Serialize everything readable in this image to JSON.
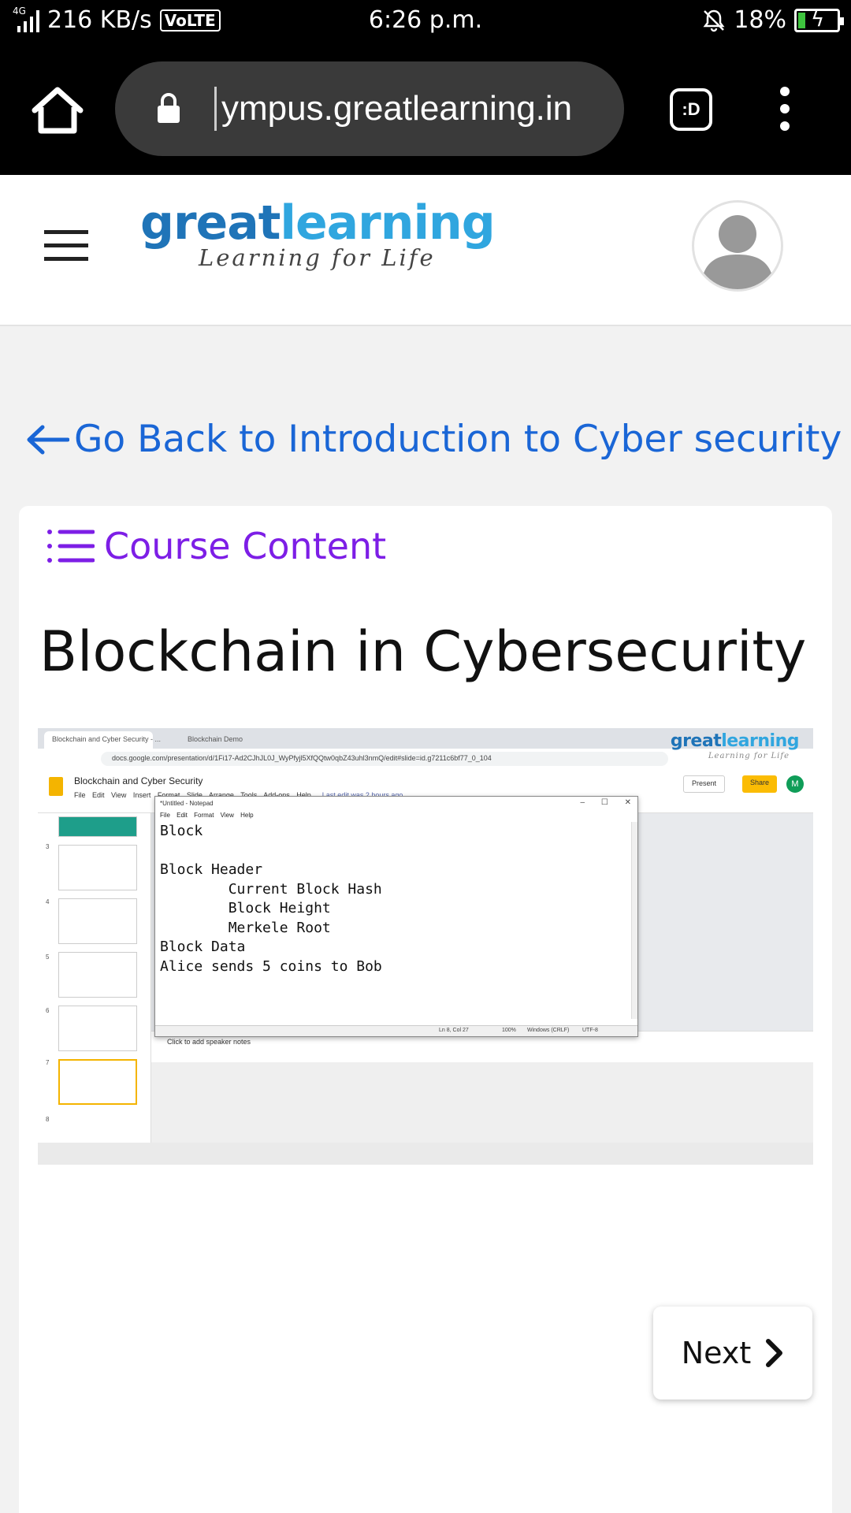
{
  "status_bar": {
    "network_type": "4G",
    "data_speed": "216 KB/s",
    "volte": "VoLTE",
    "time": "6:26 p.m.",
    "battery_percent": "18%",
    "battery_level": 0.18
  },
  "browser": {
    "url": "ympus.greatlearning.in",
    "tab_switcher_label": ":D"
  },
  "site_header": {
    "logo_part1": "great",
    "logo_part2": "learning",
    "logo_tagline": "Learning for Life"
  },
  "nav": {
    "back_link": "Go Back to Introduction to Cyber security"
  },
  "content": {
    "course_content_label": "Course Content",
    "lesson_title": "Blockchain in Cybersecurity"
  },
  "video_frame": {
    "tab1": "Blockchain and Cyber Security - ...",
    "tab2": "Blockchain Demo",
    "address": "docs.google.com/presentation/d/1Fi17-Ad2CJhJL0J_WyPfyjl5XfQQtw0qbZ43uhl3nmQ/edit#slide=id.g7211c6bf77_0_104",
    "overlay_logo_part1": "great",
    "overlay_logo_part2": "learning",
    "overlay_tagline": "Learning for Life",
    "doc_title": "Blockchain and Cyber Security",
    "menus": "File Edit View Insert Format Slide Arrange Tools Add-ons Help",
    "last_edit": "Last edit was 2 hours ago",
    "present_label": "Present",
    "share_label": "Share",
    "user_initial": "M",
    "slide_numbers": [
      "3",
      "4",
      "5",
      "6",
      "7",
      "8"
    ],
    "speaker_notes": "Click to add speaker notes",
    "notepad": {
      "title": "*Untitled - Notepad",
      "menu": "File Edit Format View Help",
      "lines": [
        "Block",
        "",
        "Block Header",
        "        Current Block Hash",
        "        Block Height",
        "        Merkele Root",
        "Block Data",
        "Alice sends 5 coins to Bob"
      ],
      "status_position": "Ln 8, Col 27",
      "status_zoom": "100%",
      "status_eol": "Windows (CRLF)",
      "status_encoding": "UTF-8"
    }
  },
  "pagination": {
    "next_label": "Next"
  },
  "colors": {
    "link_blue": "#1a66d6",
    "course_purple": "#7d1ee6",
    "logo_dark_blue": "#1f74b8",
    "logo_light_blue": "#30a6df"
  },
  "icons": [
    "home-icon",
    "lock-icon",
    "overflow-menu-icon",
    "hamburger-icon",
    "avatar-icon",
    "back-arrow-icon",
    "list-icon",
    "chevron-right-icon"
  ]
}
